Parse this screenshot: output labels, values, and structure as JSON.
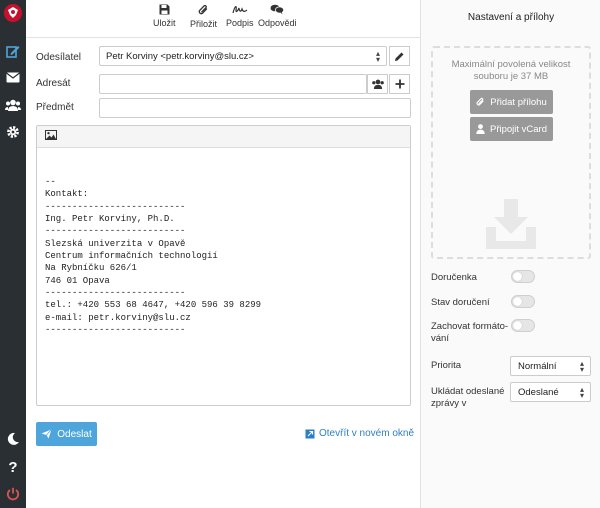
{
  "toolbar": {
    "save": "Uložit",
    "attach": "Přiložit",
    "signature": "Podpis",
    "responses": "Odpovědi"
  },
  "form": {
    "sender_label": "Odesílatel",
    "sender_value": "Petr Korviny <petr.korviny@slu.cz>",
    "recipient_label": "Adresát",
    "recipient_value": "",
    "subject_label": "Předmět",
    "subject_value": ""
  },
  "editor": {
    "body_lines": [
      "--",
      "Kontakt:",
      "--------------------------",
      "Ing. Petr Korviny, Ph.D.",
      "--------------------------",
      "Slezská univerzita v Opavě",
      "Centrum informačních technologií",
      "Na Rybníčku 626/1",
      "746 01 Opava",
      "--------------------------",
      "tel.: +420 553 68 4647, +420 596 39 8299",
      "e-mail: petr.korviny@slu.cz",
      "--------------------------"
    ]
  },
  "actions": {
    "send": "Odeslat",
    "open_new_window": "Otevřít v novém okně"
  },
  "panel": {
    "title": "Nastavení a přílohy",
    "max_size_line1": "Maximální povolená velikost",
    "max_size_line2": "souboru je 37 MB",
    "add_attachment": "Přidat přílohu",
    "attach_vcard": "Připojit vCard",
    "receipt": "Doručenka",
    "delivery_status": "Stav doručení",
    "keep_format_line1": "Zachovat formáto-",
    "keep_format_line2": "vání",
    "priority_label": "Priorita",
    "priority_value": "Normální",
    "save_sent_line1": "Ukládat odeslané",
    "save_sent_line2": "zprávy v",
    "save_sent_value": "Odeslané"
  },
  "colors": {
    "nav_bg": "#2a2f33",
    "accent": "#4ea5dc",
    "logout": "#d9534f",
    "panel_button": "#999999"
  },
  "icons": {
    "nav": [
      "logo-icon",
      "compose-icon",
      "mail-icon",
      "contacts-icon",
      "settings-icon",
      "dark-mode-icon",
      "help-icon",
      "logout-icon"
    ],
    "toolbar": [
      "save-icon",
      "paperclip-icon",
      "signature-icon",
      "responses-icon"
    ]
  }
}
